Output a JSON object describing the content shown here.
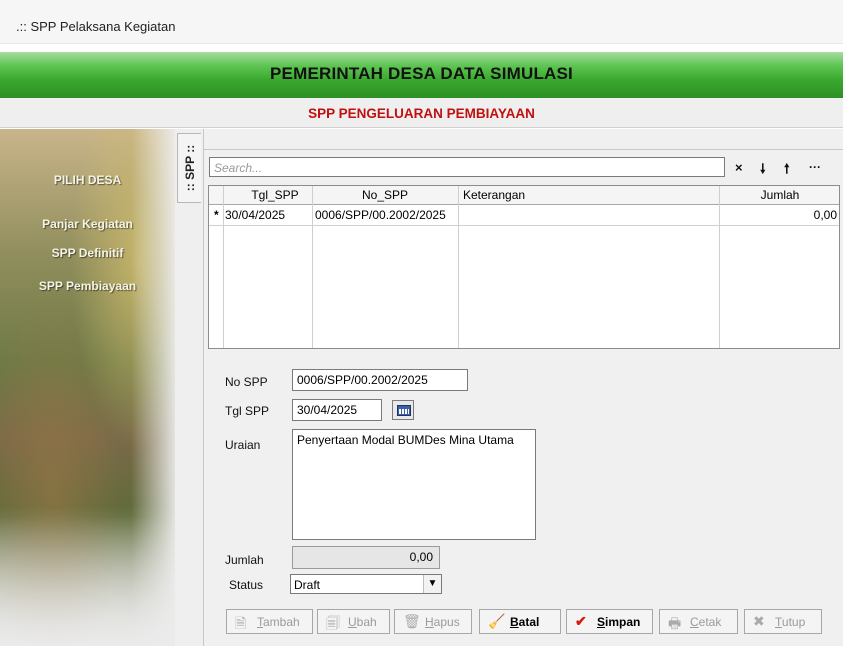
{
  "window": {
    "title": ".:: SPP Pelaksana Kegiatan"
  },
  "header": {
    "title": "PEMERINTAH DESA DATA SIMULASI"
  },
  "subheader": {
    "title": "SPP PENGELUARAN PEMBIAYAAN"
  },
  "sidebar": {
    "items": [
      {
        "label": "PILIH DESA"
      },
      {
        "label": "Panjar Kegiatan"
      },
      {
        "label": "SPP Definitif"
      },
      {
        "label": "SPP Pembiayaan"
      }
    ]
  },
  "tab": {
    "label": ":: SPP ::"
  },
  "search": {
    "placeholder": "Search..."
  },
  "search_buttons": {
    "clear": "×",
    "down": "🠗",
    "up": "🠕",
    "more": "···"
  },
  "grid": {
    "columns": [
      "Tgl_SPP",
      "No_SPP",
      "Keterangan",
      "Jumlah"
    ],
    "rows": [
      {
        "marker": "*",
        "tgl": "30/04/2025",
        "no": "0006/SPP/00.2002/2025",
        "ket": "",
        "jumlah": "0,00"
      }
    ]
  },
  "form": {
    "no_spp_label": "No SPP",
    "no_spp_value": "0006/SPP/00.2002/2025",
    "tgl_spp_label": "Tgl SPP",
    "tgl_spp_value": "30/04/2025",
    "uraian_label": "Uraian",
    "uraian_value": "Penyertaan Modal BUMDes Mina Utama",
    "jumlah_label": "Jumlah",
    "jumlah_value": "0,00",
    "status_label": "Status",
    "status_value": "Draft"
  },
  "buttons": {
    "tambah": {
      "first": "T",
      "rest": "ambah"
    },
    "ubah": {
      "first": "U",
      "rest": "bah"
    },
    "hapus": {
      "first": "H",
      "rest": "apus"
    },
    "batal": {
      "first": "B",
      "rest": "atal"
    },
    "simpan": {
      "first": "S",
      "rest": "impan"
    },
    "cetak": {
      "first": "C",
      "rest": "etak"
    },
    "tutup": {
      "first": "T",
      "rest": "utup"
    }
  }
}
